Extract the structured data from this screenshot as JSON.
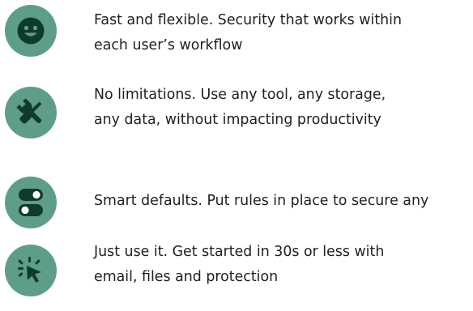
{
  "features": [
    {
      "icon": "smiley-face-icon",
      "line1": "Fast and flexible. Security that works within",
      "line2": "each user’s workflow"
    },
    {
      "icon": "wrench-screwdriver-icon",
      "line1": "No limitations. Use any tool, any storage,",
      "line2": "any data, without impacting productivity"
    },
    {
      "icon": "toggle-switches-icon",
      "line1": "Smart defaults. Put rules in place to secure any",
      "line2": ""
    },
    {
      "icon": "click-cursor-icon",
      "line1": "Just use it. Get started in 30s or less with",
      "line2": "email, files and protection"
    }
  ],
  "colors": {
    "badge": "#5e9e88",
    "icon_dark": "#0f3a2e",
    "icon_light": "#ffffff",
    "text": "#1f1f1f"
  }
}
